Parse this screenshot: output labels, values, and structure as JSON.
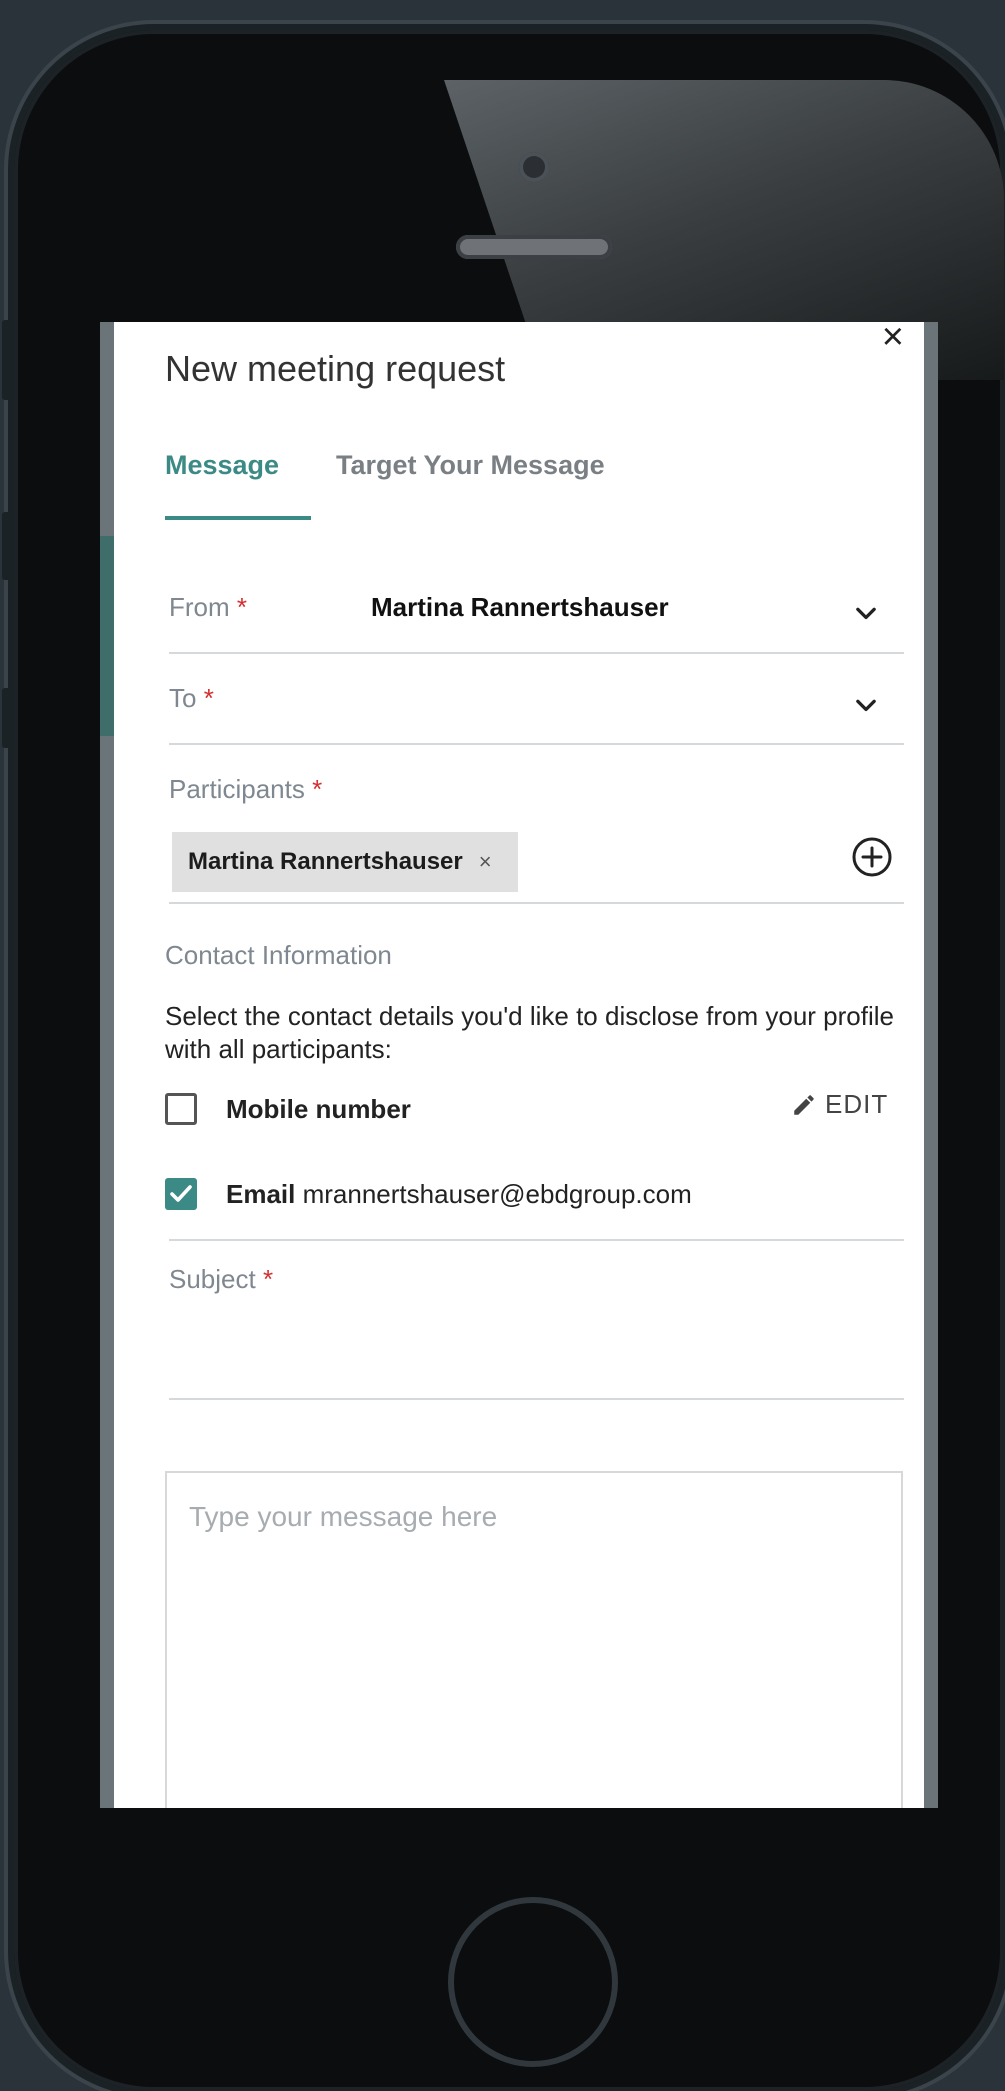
{
  "dialog": {
    "title": "New meeting request",
    "close_label": "×"
  },
  "tabs": [
    {
      "label": "Message",
      "active": true
    },
    {
      "label": "Target Your Message",
      "active": false
    }
  ],
  "form": {
    "from": {
      "label": "From",
      "required_mark": "*",
      "value": "Martina Rannertshauser"
    },
    "to": {
      "label": "To",
      "required_mark": "*",
      "value": ""
    },
    "participants": {
      "label": "Participants",
      "required_mark": "*",
      "chips": [
        {
          "label": "Martina Rannertshauser",
          "remove": "×"
        }
      ]
    },
    "contact": {
      "section_title": "Contact Information",
      "description": "Select the contact details you'd like to disclose from your profile with all participants:",
      "mobile": {
        "label": "Mobile number",
        "checked": false,
        "edit_label": "EDIT"
      },
      "email": {
        "label": "Email",
        "value": "mrannertshauser@ebdgroup.com",
        "checked": true
      }
    },
    "subject": {
      "label": "Subject",
      "required_mark": "*",
      "value": ""
    },
    "message": {
      "placeholder": "Type your message here",
      "value": ""
    }
  },
  "colors": {
    "accent": "#3b8a86",
    "required": "#d32f2f"
  }
}
